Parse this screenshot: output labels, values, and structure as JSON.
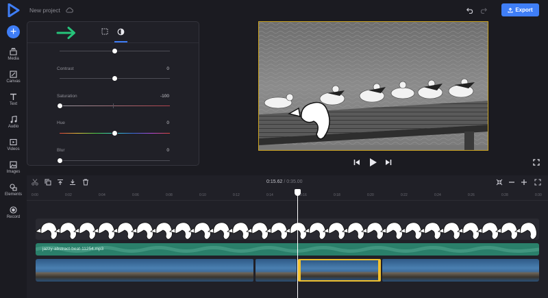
{
  "header": {
    "project_name": "New project",
    "export_label": "Export"
  },
  "rail": {
    "items": [
      {
        "label": "Media",
        "icon": "media-icon"
      },
      {
        "label": "Canvas",
        "icon": "canvas-icon"
      },
      {
        "label": "Text",
        "icon": "text-icon"
      },
      {
        "label": "Audio",
        "icon": "audio-icon"
      },
      {
        "label": "Videos",
        "icon": "videos-icon"
      },
      {
        "label": "Images",
        "icon": "images-icon"
      },
      {
        "label": "Elements",
        "icon": "elements-icon"
      },
      {
        "label": "Record",
        "icon": "record-icon"
      }
    ]
  },
  "adjust": {
    "top_slider_level": 0.5,
    "contrast": {
      "label": "Contrast",
      "value": "0",
      "level": 0.5
    },
    "saturation": {
      "label": "Saturation",
      "value": "-100",
      "level": 0.0
    },
    "hue": {
      "label": "Hue",
      "value": "0",
      "level": 0.5
    },
    "blur": {
      "label": "Blur",
      "value": "0",
      "level": 0.0
    }
  },
  "timeline": {
    "current_time": "0:15.62",
    "separator": "/",
    "total_time": "0:35.00",
    "ruler_ticks": [
      "0:00",
      "0:02",
      "0:04",
      "0:06",
      "0:08",
      "0:10",
      "0:12",
      "0:14",
      "0:16",
      "0:18",
      "0:20",
      "0:22",
      "0:24",
      "0:26",
      "0:28",
      "0:30"
    ],
    "audio_clip": "jazzy-abstract-beat-11254.mp3"
  },
  "colors": {
    "accent": "#3f7ef7",
    "selection": "#f0c02e",
    "audio_track": "#2a7f6a",
    "arrow": "#26c47a"
  }
}
